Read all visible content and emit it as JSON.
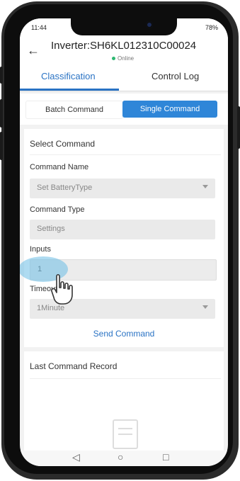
{
  "statusbar": {
    "time": "11:44",
    "battery": "78%"
  },
  "header": {
    "title": "Inverter:SH6KL012310C00024",
    "status": "Online"
  },
  "tabs": [
    {
      "label": "Classification"
    },
    {
      "label": "Control Log"
    }
  ],
  "segment": {
    "batch_label": "Batch Command",
    "single_label": "Single Command"
  },
  "form": {
    "section_title": "Select Command",
    "command_name_label": "Command Name",
    "command_name_value": "Set BatteryType",
    "command_type_label": "Command Type",
    "command_type_value": "Settings",
    "inputs_label": "Inputs",
    "inputs_value": "1",
    "timeout_label": "Timeout",
    "timeout_value": "1Minute",
    "send_label": "Send Command"
  },
  "record": {
    "title": "Last Command Record"
  },
  "colors": {
    "accent": "#2a73c4",
    "segment_active": "#2f86d8",
    "online": "#2eb872"
  }
}
